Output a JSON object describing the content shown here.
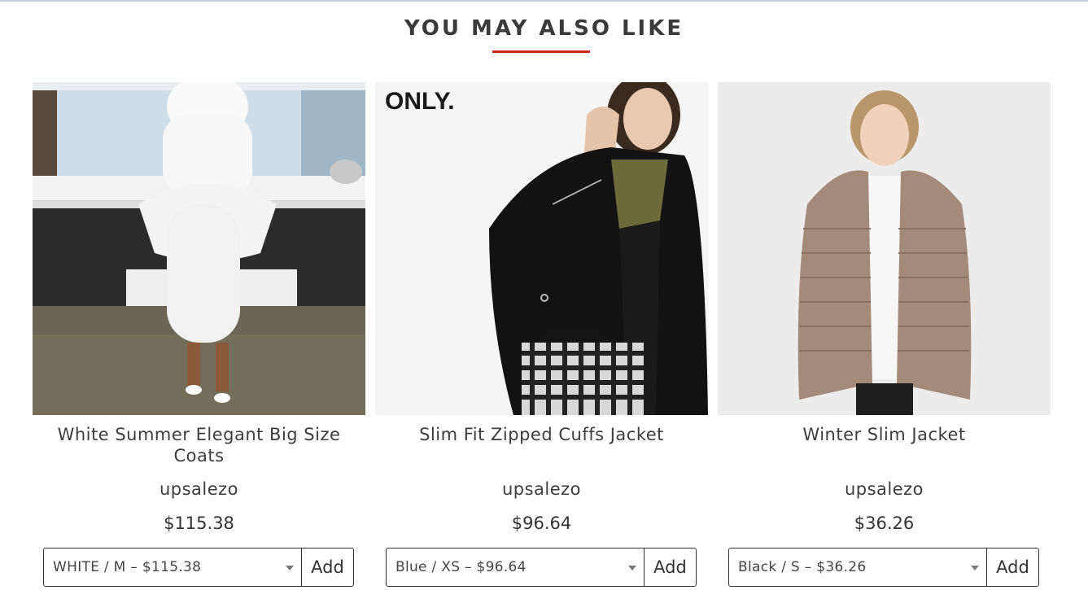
{
  "section": {
    "title": "YOU MAY ALSO LIKE",
    "accent_color": "#d0241c"
  },
  "products": [
    {
      "title": "White Summer Elegant Big Size Coats",
      "vendor": "upsalezo",
      "price": "$115.38",
      "variant": "WHITE / M – $115.38",
      "add_label": "Add"
    },
    {
      "title": "Slim Fit Zipped Cuffs Jacket",
      "vendor": "upsalezo",
      "price": "$96.64",
      "variant": "Blue / XS – $96.64",
      "add_label": "Add",
      "brand_logo": "ONLY."
    },
    {
      "title": "Winter Slim Jacket",
      "vendor": "upsalezo",
      "price": "$36.26",
      "variant": "Black / S – $36.26",
      "add_label": "Add"
    }
  ]
}
